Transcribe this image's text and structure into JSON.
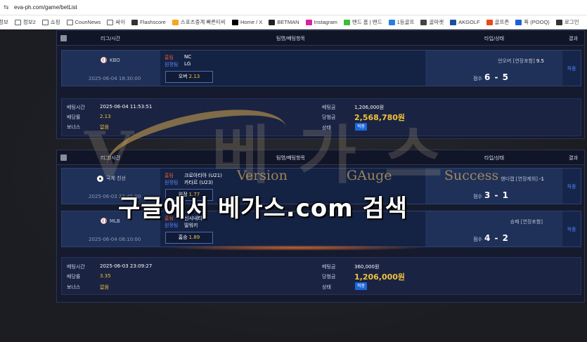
{
  "browser": {
    "url": "eva-ph.com/game/betList"
  },
  "bookmarks": [
    {
      "label": "정보",
      "icon": "none"
    },
    {
      "label": "정보2",
      "icon": "folder"
    },
    {
      "label": "쇼핑",
      "icon": "folder"
    },
    {
      "label": "CounNews",
      "icon": "folder"
    },
    {
      "label": "싸이",
      "icon": "folder"
    },
    {
      "label": "Flashscore",
      "icon": "flashscore"
    },
    {
      "label": "스포츠중계 빠른티비",
      "icon": "tv"
    },
    {
      "label": "Home / X",
      "icon": "x"
    },
    {
      "label": "BETMAN",
      "icon": "betman"
    },
    {
      "label": "Instagram",
      "icon": "instagram"
    },
    {
      "label": "밴드 홈 | 밴드",
      "icon": "band"
    },
    {
      "label": "1등골프",
      "icon": "golf"
    },
    {
      "label": "골마켓",
      "icon": "golmarket"
    },
    {
      "label": "AKGOLF",
      "icon": "akgolf"
    },
    {
      "label": "골프존",
      "icon": "golfzon"
    },
    {
      "label": "푹 (POOQ)",
      "icon": "pooq"
    },
    {
      "label": "로그인",
      "icon": "w"
    }
  ],
  "colors": {
    "panel_bg": "#151a2e",
    "game_row": "#1f3158",
    "home_label": "#e0582e",
    "away_label": "#5b8bff",
    "odds": "#f2c23a",
    "badge": "#1c66d9"
  },
  "table_headers": {
    "league_time": "리그/시간",
    "team_pick": "팀명/베팅항목",
    "type_status": "타입/상태",
    "result": "결과"
  },
  "labels": {
    "home": "홈팀",
    "away": "원정팀",
    "score": "점수",
    "bet_time": "베팅시간",
    "odds": "배당률",
    "bonus": "보너스",
    "bet_amount": "베팅금",
    "win_amount": "당첨금",
    "status": "상태"
  },
  "bets": [
    {
      "games": [
        {
          "league": "KBO",
          "sport_icon": "baseball",
          "time": "2025-06-04 18:30:00",
          "home": "NC",
          "away": "LG",
          "pick": "오버",
          "pick_odds": "2.13",
          "bet_type": "언오버 [연장포함]",
          "bet_line": "9.5",
          "score": "6 - 5",
          "result": "적중"
        }
      ],
      "summary": {
        "bet_time": "2025-06-04 11:53:51",
        "odds": "2.13",
        "bonus": "없음",
        "bet_amount": "1,206,000원",
        "win_amount": "2,568,780원",
        "status": "적중"
      }
    },
    {
      "games": [
        {
          "league": "국제 친선",
          "sport_icon": "soccer",
          "time": "2025-06-03 23:45:00",
          "home": "크로아티아 (U21)",
          "away": "카타르 (U23)",
          "pick": "원정",
          "pick_odds": "1.77",
          "bet_type": "핸디캡 [연장제외]",
          "bet_line": "-1",
          "score": "3 - 1",
          "result": "적중"
        },
        {
          "league": "MLB",
          "sport_icon": "baseball",
          "time": "2025-06-04 08:10:00",
          "home": "신시내티",
          "away": "밀워키",
          "pick": "홈승",
          "pick_odds": "1.89",
          "bet_type": "승패 [연장포함]",
          "bet_line": "",
          "score": "4 - 2",
          "result": "적중"
        }
      ],
      "summary": {
        "bet_time": "2025-06-03 23:09:27",
        "odds": "3.35",
        "bonus": "없음",
        "bet_amount": "360,000원",
        "win_amount": "1,206,000원",
        "status": "적중"
      }
    }
  ],
  "watermark": {
    "logo_text": "V 베가스",
    "sub_words": [
      "Version",
      "GAuge",
      "Success"
    ],
    "search_text": "구글에서 베가스.com 검색"
  }
}
